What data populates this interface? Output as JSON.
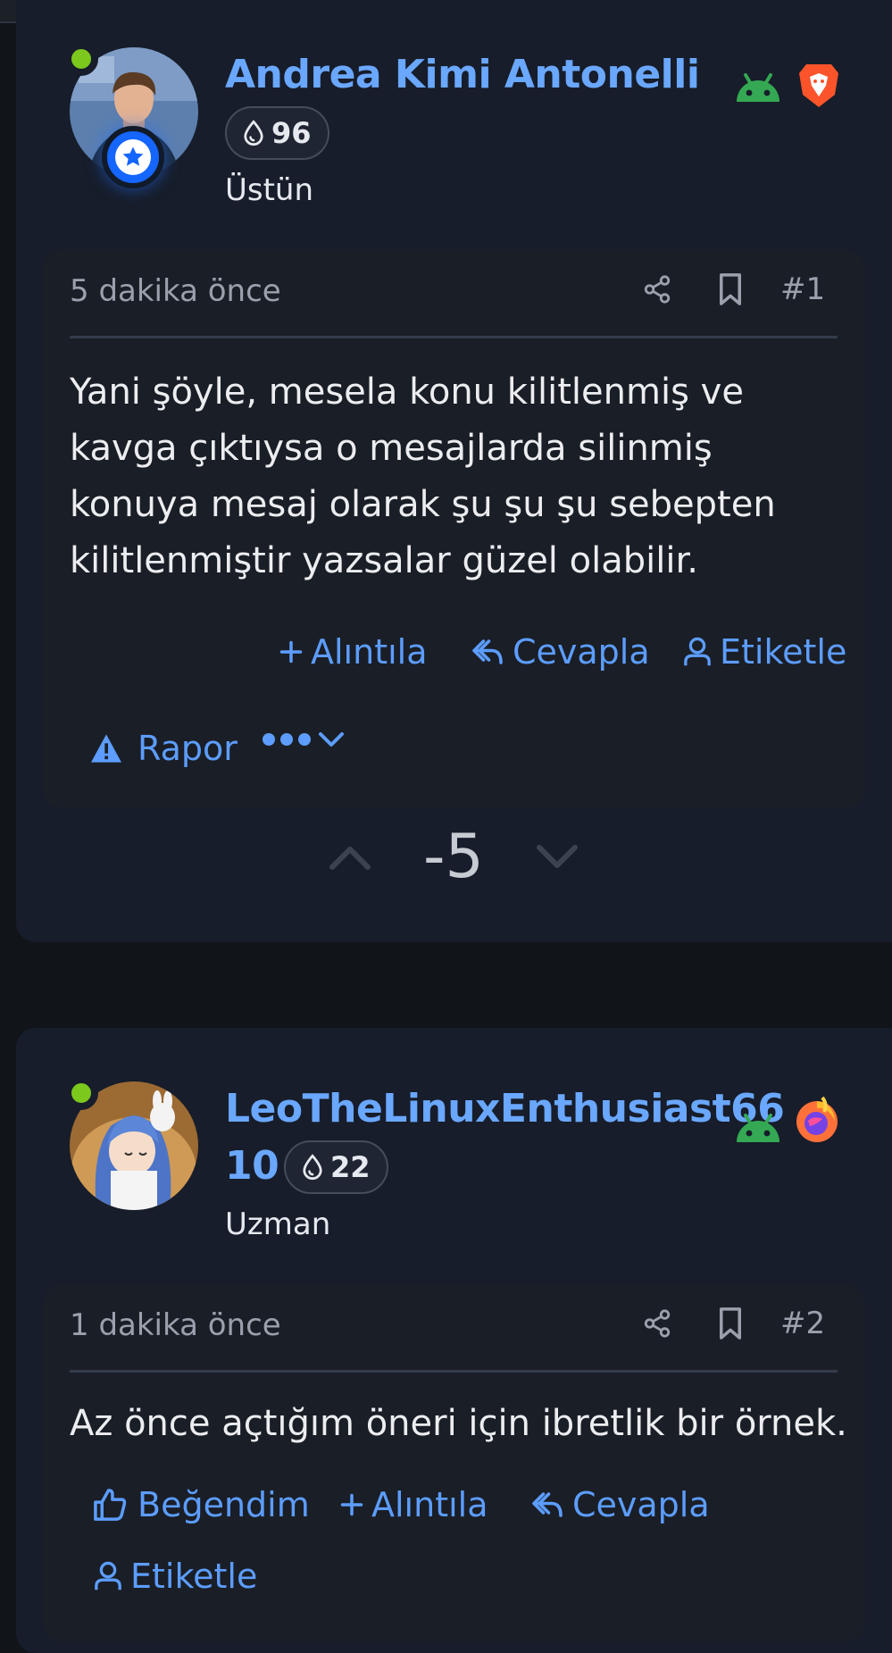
{
  "posts": [
    {
      "username": "Andrea Kimi Antonelli",
      "reputation": "96",
      "user_title": "Üstün",
      "platform_icons": [
        "android-icon",
        "brave-browser-icon"
      ],
      "timestamp": "5 dakika önce",
      "post_number": "#1",
      "body_lines": [
        "Yani şöyle, mesela konu kilitlenmiş ve",
        "kavga çıktıysa o mesajlarda silinmiş",
        "konuya mesaj olarak şu şu şu sebepten",
        "kilitlenmiştir yazsalar güzel olabilir."
      ],
      "actions": {
        "quote": "Alıntıla",
        "reply": "Cevapla",
        "tag": "Etiketle",
        "report": "Rapor"
      },
      "vote_count": "-5"
    },
    {
      "username_line1": "LeoTheLinuxEnthusiast66",
      "username_line2": "10",
      "reputation": "22",
      "user_title": "Uzman",
      "platform_icons": [
        "android-icon",
        "firefox-icon"
      ],
      "timestamp": "1 dakika önce",
      "post_number": "#2",
      "body": "Az önce açtığım öneri için ibretlik bir örnek.",
      "actions": {
        "like": "Beğendim",
        "quote": "Alıntıla",
        "reply": "Cevapla",
        "tag": "Etiketle"
      }
    }
  ],
  "colors": {
    "accent": "#5c9dff",
    "online": "#7cc81d",
    "background": "#111419",
    "card": "#171d2a"
  }
}
